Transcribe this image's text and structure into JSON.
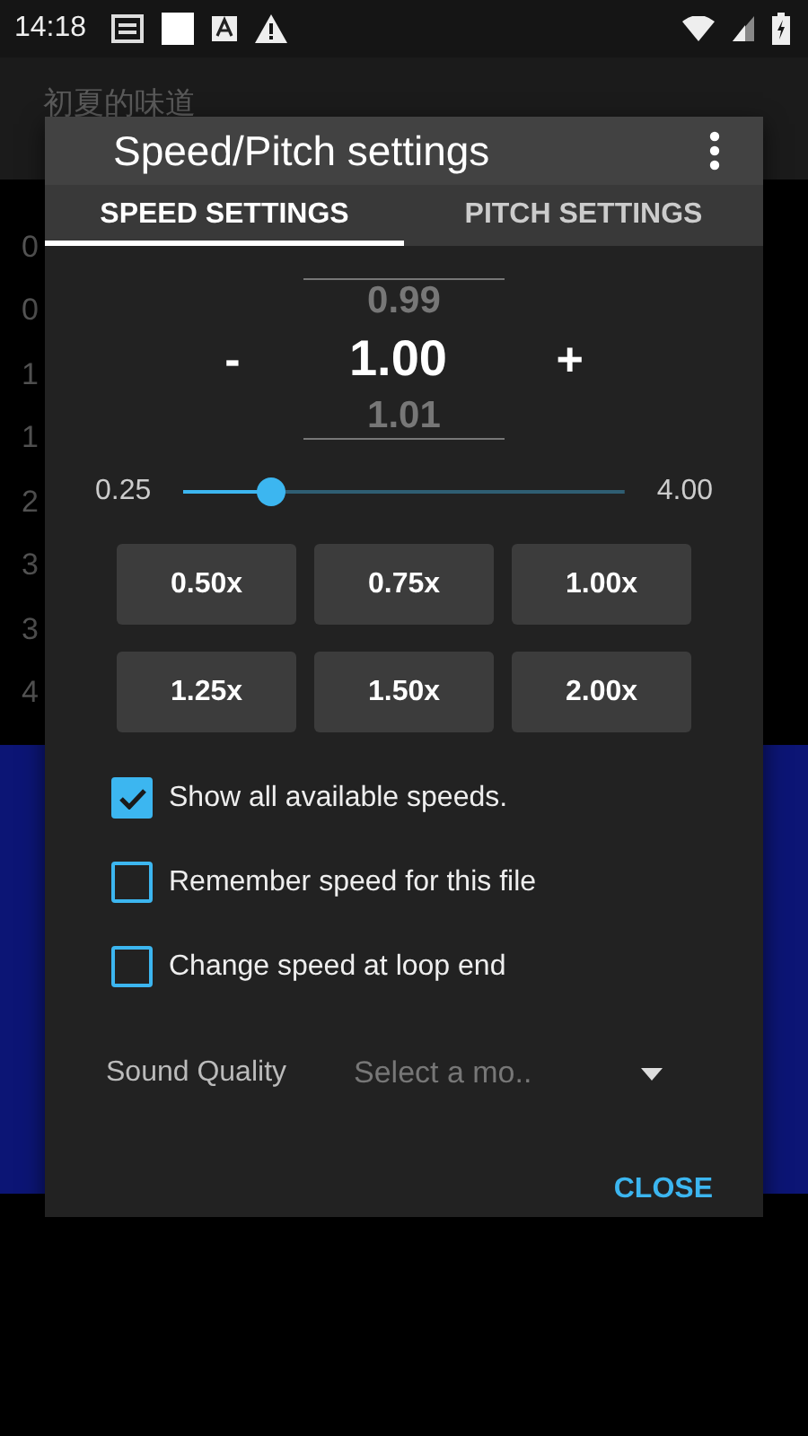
{
  "status_bar": {
    "time": "14:18"
  },
  "app": {
    "title": "初夏的味道",
    "list": [
      "0",
      "0",
      "1",
      "1",
      "2",
      "3",
      "3",
      "4"
    ]
  },
  "dialog": {
    "title": "Speed/Pitch settings",
    "tabs": [
      {
        "label": "SPEED SETTINGS",
        "selected": true
      },
      {
        "label": "PITCH SETTINGS",
        "selected": false
      }
    ],
    "picker": {
      "previous": "0.99",
      "value": "1.00",
      "next": "1.01",
      "minus": "-",
      "plus": "+"
    },
    "slider": {
      "min": "0.25",
      "max": "4.00",
      "level": 0.2
    },
    "presets": [
      "0.50x",
      "0.75x",
      "1.00x",
      "1.25x",
      "1.50x",
      "2.00x"
    ],
    "options": [
      {
        "label": "Show all available speeds.",
        "checked": true
      },
      {
        "label": "Remember speed for this file",
        "checked": false
      },
      {
        "label": "Change speed at loop end",
        "checked": false
      }
    ],
    "sound_quality": {
      "label": "Sound Quality",
      "placeholder": "Select a mo.."
    },
    "close": "CLOSE"
  }
}
